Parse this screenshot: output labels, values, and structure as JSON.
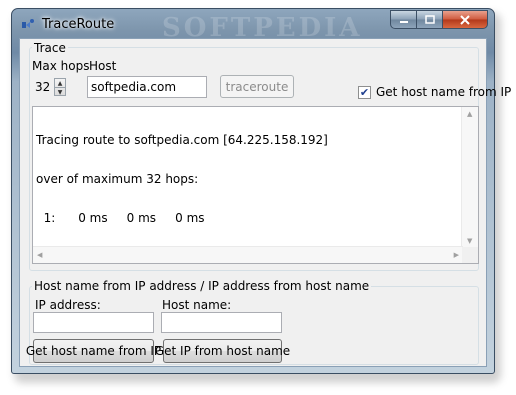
{
  "window": {
    "title": "TraceRoute",
    "watermark": "SOFTPEDIA"
  },
  "trace": {
    "group_label": "Trace",
    "max_hops_label": "Max hops",
    "max_hops_value": "32",
    "host_label": "Host",
    "host_value": "softpedia.com",
    "traceroute_button": "traceroute",
    "get_host_name_checkbox_label": "Get host name from IP",
    "get_host_name_checked": true,
    "output_lines": [
      "Tracing route to softpedia.com [64.225.158.192]",
      "over of maximum 32 hops:",
      "  1:      0 ms     0 ms     0 ms"
    ]
  },
  "lookup": {
    "group_label": "Host name from IP address / IP address from host name",
    "ip_label": "IP address:",
    "ip_value": "",
    "host_name_label": "Host name:",
    "host_name_value": "",
    "get_host_name_button": "Get host name from IP",
    "get_ip_button": "Get IP from host name"
  },
  "colors": {
    "accent": "#1f3f8f",
    "close_button": "#cf5a3e"
  }
}
